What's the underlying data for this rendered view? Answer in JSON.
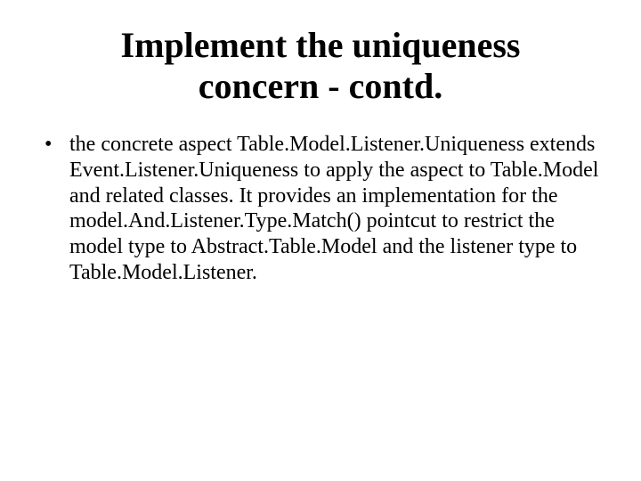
{
  "title_line1": "Implement the uniqueness",
  "title_line2": "concern - contd.",
  "bullet1": "the concrete aspect Table.Model.Listener.Uniqueness extends Event.Listener.Uniqueness to apply the aspect to Table.Model and related classes. It provides an implementation for the model.And.Listener.Type.Match() pointcut to restrict the model type to Abstract.Table.Model and the listener type to Table.Model.Listener."
}
